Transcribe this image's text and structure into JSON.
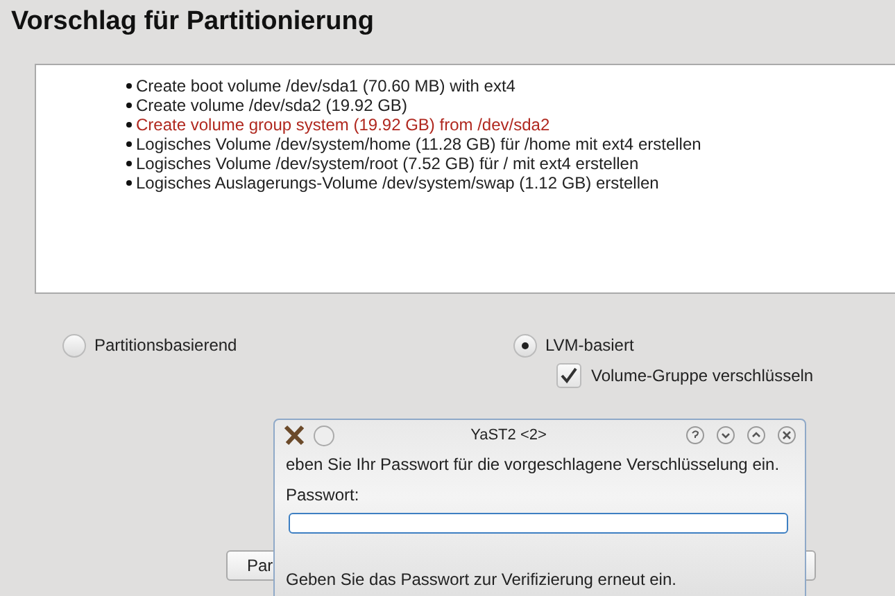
{
  "title": "Vorschlag für Partitionierung",
  "proposal": [
    {
      "text": "Create boot volume /dev/sda1 (70.60 MB) with ext4",
      "highlighted": false
    },
    {
      "text": "Create volume /dev/sda2 (19.92 GB)",
      "highlighted": false
    },
    {
      "text": "Create volume group system (19.92 GB) from /dev/sda2",
      "highlighted": true
    },
    {
      "text": "Logisches Volume /dev/system/home (11.28 GB) für /home mit ext4 erstellen",
      "highlighted": false
    },
    {
      "text": "Logisches Volume /dev/system/root (7.52 GB) für / mit ext4 erstellen",
      "highlighted": false
    },
    {
      "text": "Logisches Auslagerungs-Volume /dev/system/swap (1.12 GB) erstellen",
      "highlighted": false
    }
  ],
  "options": [
    {
      "label": "Partitionsbasierend",
      "selected": false
    },
    {
      "label": "LVM-basiert",
      "selected": true
    }
  ],
  "encrypt": {
    "label": "Volume-Gruppe verschlüsseln",
    "checked": true
  },
  "button": {
    "label": "Par"
  },
  "dialog": {
    "title": "YaST2 <2>",
    "message": "eben Sie Ihr Passwort für die vorgeschlagene Verschlüsselung ein.",
    "password_label": "Passwort:",
    "verify_label": "Geben Sie das Passwort zur Verifizierung erneut ein."
  }
}
